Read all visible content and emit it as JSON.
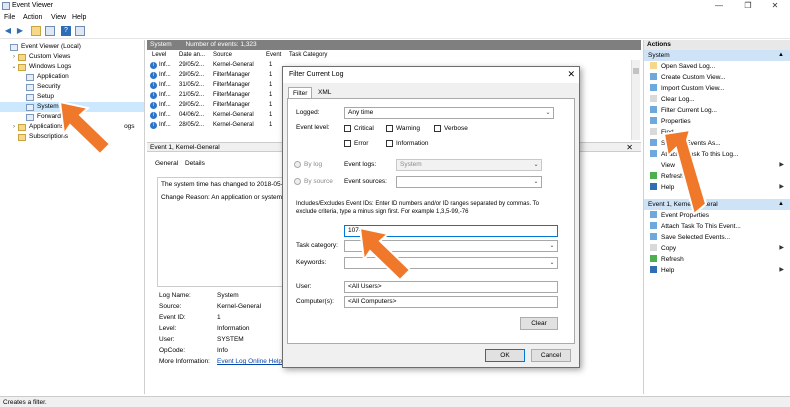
{
  "window": {
    "title": "Event Viewer",
    "controls": [
      "—",
      "❐",
      "✕"
    ]
  },
  "menu": [
    "File",
    "Action",
    "View",
    "Help"
  ],
  "tree": {
    "items": [
      {
        "label": "Event Viewer (Local)",
        "indent": 0,
        "twisty": ""
      },
      {
        "label": "Custom Views",
        "indent": 1,
        "twisty": "›"
      },
      {
        "label": "Windows Logs",
        "indent": 1,
        "twisty": "⌄"
      },
      {
        "label": "Application",
        "indent": 2,
        "twisty": ""
      },
      {
        "label": "Security",
        "indent": 2,
        "twisty": ""
      },
      {
        "label": "Setup",
        "indent": 2,
        "twisty": ""
      },
      {
        "label": "System",
        "indent": 2,
        "twisty": "",
        "selected": true
      },
      {
        "label": "Forwarde",
        "indent": 2,
        "twisty": ""
      },
      {
        "label": "Applications",
        "indent": 1,
        "twisty": "›",
        "suffix": "ogs"
      },
      {
        "label": "Subscriptions",
        "indent": 1,
        "twisty": ""
      }
    ]
  },
  "events": {
    "header_title": "System",
    "header_count": "Number of events: 1,323",
    "columns": [
      "Level",
      "Date an...",
      "Source",
      "Event",
      "Task Category"
    ],
    "rows": [
      {
        "level": "Inf...",
        "date": "29/05/2...",
        "source": "Kernel-General",
        "event": "1"
      },
      {
        "level": "Inf...",
        "date": "29/05/2...",
        "source": "FilterManager",
        "event": "1"
      },
      {
        "level": "Inf...",
        "date": "31/05/2...",
        "source": "FilterManager",
        "event": "1"
      },
      {
        "level": "Inf...",
        "date": "21/05/2...",
        "source": "FilterManager",
        "event": "1"
      },
      {
        "level": "Inf...",
        "date": "29/05/2...",
        "source": "FilterManager",
        "event": "1"
      },
      {
        "level": "Inf...",
        "date": "04/06/2...",
        "source": "Kernel-General",
        "event": "1"
      },
      {
        "level": "Inf...",
        "date": "28/05/2...",
        "source": "Kernel-General",
        "event": "1"
      }
    ]
  },
  "details": {
    "header": "Event 1, Kernel-General",
    "tabs": [
      "General",
      "Details"
    ],
    "message_line1": "The system time has changed to 2018-05-",
    "message_line2": "Change Reason: An application or system",
    "fields": [
      {
        "label": "Log Name:",
        "value": "System"
      },
      {
        "label": "Source:",
        "value": "Kernel-General"
      },
      {
        "label": "Event ID:",
        "value": "1"
      },
      {
        "label": "Level:",
        "value": "Information"
      },
      {
        "label": "User:",
        "value": "SYSTEM"
      },
      {
        "label": "OpCode:",
        "value": "Info"
      },
      {
        "label": "More Information:",
        "value": "Event Log Online Help"
      }
    ]
  },
  "actions": {
    "header": "Actions",
    "sections": [
      {
        "title": "System",
        "items": [
          {
            "label": "Open Saved Log...",
            "arrow": false
          },
          {
            "label": "Create Custom View...",
            "arrow": false
          },
          {
            "label": "Import Custom View...",
            "arrow": false
          },
          {
            "label": "Clear Log...",
            "arrow": false
          },
          {
            "label": "Filter Current Log...",
            "arrow": false
          },
          {
            "label": "Properties",
            "arrow": false
          },
          {
            "label": "Find...",
            "arrow": false
          },
          {
            "label": "Save All Events As...",
            "arrow": false
          },
          {
            "label": "Attach a Task To this Log...",
            "arrow": false
          },
          {
            "label": "View",
            "arrow": true
          },
          {
            "label": "Refresh",
            "arrow": false
          },
          {
            "label": "Help",
            "arrow": true
          }
        ]
      },
      {
        "title": "Event 1, Kernel-General",
        "items": [
          {
            "label": "Event Properties",
            "arrow": false
          },
          {
            "label": "Attach Task To This Event...",
            "arrow": false
          },
          {
            "label": "Save Selected Events...",
            "arrow": false
          },
          {
            "label": "Copy",
            "arrow": true
          },
          {
            "label": "Refresh",
            "arrow": false
          },
          {
            "label": "Help",
            "arrow": true
          }
        ]
      }
    ]
  },
  "status": "Creates a filter.",
  "dialog": {
    "title": "Filter Current Log",
    "tabs": [
      "Filter",
      "XML"
    ],
    "logged_label": "Logged:",
    "logged_value": "Any time",
    "event_level_label": "Event level:",
    "levels": [
      "Critical",
      "Warning",
      "Verbose",
      "Error",
      "Information"
    ],
    "by_log": "By log",
    "by_source": "By source",
    "event_logs_label": "Event logs:",
    "event_logs_value": "System",
    "event_sources_label": "Event sources:",
    "help_text1": "Includes/Excludes Event IDs: Enter ID numbers and/or ID ranges separated by commas. To",
    "help_text2": "exclude criteria, type a minus sign first. For example 1,3,5-99,-76",
    "event_id_value": "1074",
    "task_category_label": "Task category:",
    "keywords_label": "Keywords:",
    "user_label": "User:",
    "user_value": "<All Users>",
    "computers_label": "Computer(s):",
    "computers_value": "<All Computers>",
    "clear_label": "Clear",
    "ok_label": "OK",
    "cancel_label": "Cancel"
  },
  "colors": {
    "accent": "#0078d7",
    "arrow": "#f0782a",
    "selection": "#cce8ff"
  }
}
